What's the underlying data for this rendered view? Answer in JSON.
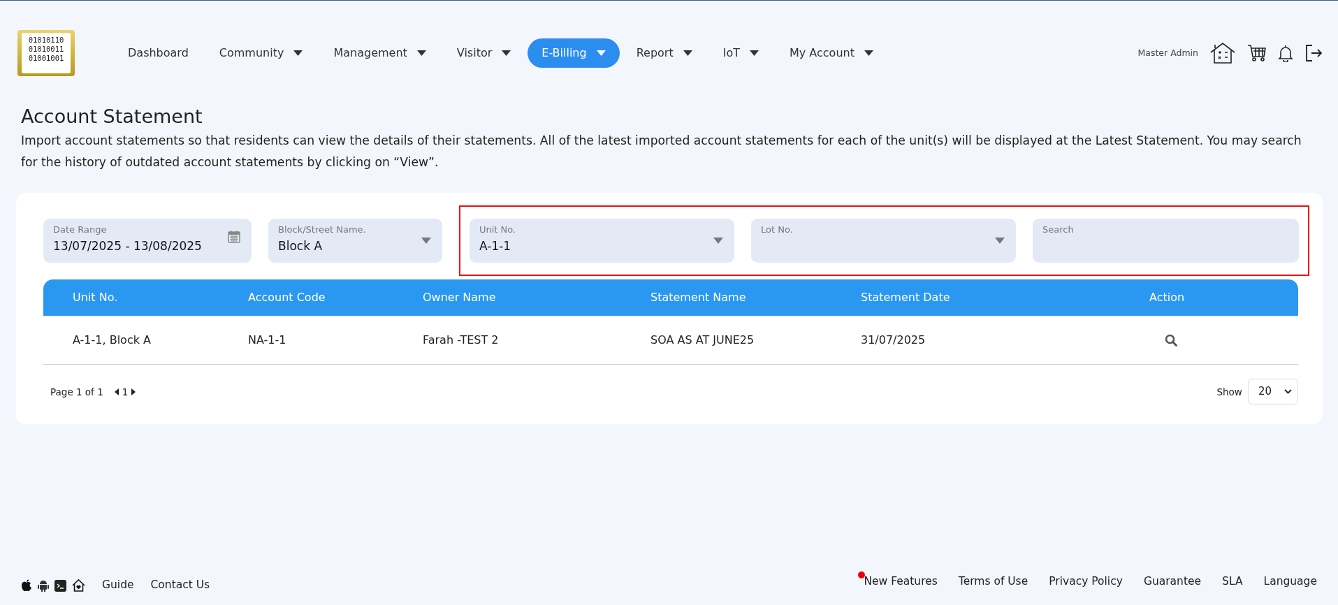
{
  "nav": {
    "items": [
      {
        "label": "Dashboard",
        "dropdown": false,
        "selected": false
      },
      {
        "label": "Community",
        "dropdown": true,
        "selected": false
      },
      {
        "label": "Management",
        "dropdown": true,
        "selected": false
      },
      {
        "label": "Visitor",
        "dropdown": true,
        "selected": false
      },
      {
        "label": "E-Billing",
        "dropdown": true,
        "selected": true
      },
      {
        "label": "Report",
        "dropdown": true,
        "selected": false
      },
      {
        "label": "IoT",
        "dropdown": true,
        "selected": false
      },
      {
        "label": "My Account",
        "dropdown": true,
        "selected": false
      }
    ],
    "user": "Master Admin",
    "logo_lines": [
      "01010110",
      "01010011",
      "01001001"
    ]
  },
  "page": {
    "title": "Account Statement",
    "description": "Import account statements so that residents can view the details of their statements. All of the latest imported account statements for each of the unit(s) will be displayed at the Latest Statement. You may search for the history of outdated account statements by clicking on “View”."
  },
  "filters": [
    {
      "kind": "date",
      "label": "Date Range",
      "value": "13/07/2025 - 13/08/2025",
      "highlighted": false
    },
    {
      "kind": "select",
      "label": "Block/Street Name.",
      "value": "Block A",
      "highlighted": false
    },
    {
      "kind": "select",
      "label": "Unit No.",
      "value": "A-1-1",
      "highlighted": true
    },
    {
      "kind": "select",
      "label": "Lot No.",
      "highlighted": true
    },
    {
      "kind": "text",
      "label": "Search",
      "highlighted": true
    }
  ],
  "table": {
    "columns": [
      "Unit No.",
      "Account Code",
      "Owner Name",
      "Statement Name",
      "Statement Date",
      "Action"
    ],
    "rows": [
      {
        "cells": [
          "A-1-1, Block A",
          "NA-1-1",
          "Farah -TEST 2",
          "SOA AS AT JUNE25",
          "31/07/2025"
        ]
      }
    ]
  },
  "pagination": {
    "page_info": "Page 1 of 1",
    "page": "1",
    "show_label": "Show",
    "page_size": "20"
  },
  "footer": {
    "left_links": [
      "Guide",
      "Contact Us"
    ],
    "right_links": [
      {
        "label": "New Features",
        "new_dot": true
      },
      {
        "label": "Terms of Use",
        "new_dot": false
      },
      {
        "label": "Privacy Policy",
        "new_dot": false
      },
      {
        "label": "Guarantee",
        "new_dot": false
      },
      {
        "label": "SLA",
        "new_dot": false
      },
      {
        "label": "Language",
        "new_dot": false
      }
    ]
  }
}
